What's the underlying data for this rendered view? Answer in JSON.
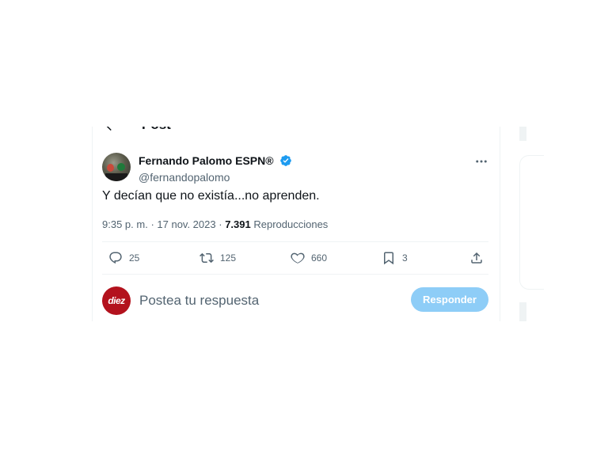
{
  "header": {
    "title": "Post",
    "back_icon": "arrow-left-icon"
  },
  "tweet": {
    "author": {
      "display_name": "Fernando Palomo ESPN®",
      "handle": "@fernandopalomo",
      "verified_color": "#1d9bf0"
    },
    "text": "Y decían que no existía...no aprenden.",
    "time": "9:35 p. m.",
    "date": "17 nov. 2023",
    "views": "7.391",
    "views_label": "Reproducciones",
    "more_icon": "more-horizontal-icon"
  },
  "actions": {
    "replies": "25",
    "reposts": "125",
    "likes": "660",
    "bookmarks": "3"
  },
  "reply": {
    "avatar_text": "diez",
    "placeholder": "Postea tu respuesta",
    "button_label": "Responder",
    "button_color": "#8ecdf7"
  }
}
